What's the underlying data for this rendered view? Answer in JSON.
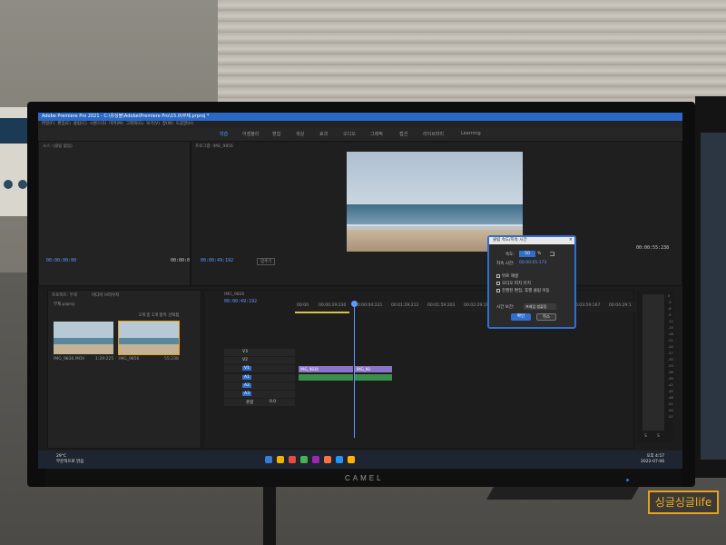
{
  "app": {
    "title": "Adobe Premiere Pro 2021 - C:\\유싱블\\Adobe\\Premiere Pro\\15.0\\무제.prproj *",
    "menu": [
      "파일(F)",
      "편집(E)",
      "클립(C)",
      "시퀀스(S)",
      "마커(M)",
      "그래픽(G)",
      "보기(V)",
      "창(W)",
      "도움말(H)"
    ],
    "workspaces": [
      "학습",
      "어셈블리",
      "편집",
      "색상",
      "효과",
      "오디오",
      "그래픽",
      "캡션",
      "라이브러리",
      "Learning"
    ],
    "active_workspace": "학습"
  },
  "source_panel": {
    "title": "소스: (클립 없음)",
    "timecode_left": "00:00:00:00",
    "timecode_right": "00:00:0"
  },
  "program_panel": {
    "title": "프로그램: IMG_9856",
    "timecode": "00:00:49:192",
    "fit": "맞추기",
    "duration": "00:00:55:238"
  },
  "project_panel": {
    "tabs": [
      "프로젝트: 무제",
      "미디어 브라우저"
    ],
    "file": "무제.prproj",
    "selection": "2개 중 1개 항목 선택됨",
    "items": [
      {
        "name": "IMG_9836.MOV",
        "duration": "1:29:225"
      },
      {
        "name": "IMG_9856",
        "duration": "55:238"
      }
    ]
  },
  "timeline": {
    "tab": "IMG_9856",
    "timecode": "00:00:49:192",
    "ruler": [
      "00:00",
      "00:00:29:230",
      "00:00:04:221",
      "00:01:29:212",
      "00:01:59:203",
      "00:02:29:194",
      "00:02:59:185",
      "00:03:29:176",
      "00:03:59:167",
      "00:04:29:1"
    ],
    "video_tracks": [
      "V3",
      "V2",
      "V1"
    ],
    "audio_tracks": [
      "A1",
      "A2",
      "A3"
    ],
    "mix_label": "혼합",
    "mix_value": "0.0",
    "clips": [
      "IMG_9836",
      "IMG_98"
    ]
  },
  "meter": {
    "ticks": [
      "0",
      "-3",
      "-6",
      "-9",
      "-12",
      "-15",
      "-18",
      "-21",
      "-24",
      "-27",
      "-30",
      "-33",
      "-36",
      "-39",
      "-42",
      "-45",
      "-48",
      "-51",
      "-54",
      "-57"
    ],
    "solo": [
      "S",
      "S"
    ]
  },
  "dialog": {
    "title": "클립 속도/지속 시간",
    "speed_label": "속도:",
    "speed_value": "50",
    "speed_unit": "%",
    "duration_label": "지속 시간:",
    "duration_value": "00:00:05:173",
    "options": [
      "뒤로 재생",
      "오디오 피치 유지",
      "진행된 편집, 후행 클립 이동"
    ],
    "interp_label": "시간 보간:",
    "interp_value": "프레임 샘플링",
    "ok": "확인",
    "cancel": "취소"
  },
  "taskbar": {
    "weather_temp": "29°C",
    "weather_desc": "부분적으로 맑음",
    "time": "오후 4:57",
    "date": "2022-07-06",
    "icon_colors": [
      "#3a7bd5",
      "#f0b400",
      "#e84c3d",
      "#4caf50",
      "#9c27b0",
      "#ff7043",
      "#2196f3",
      "#ffb300"
    ]
  },
  "monitor": {
    "brand": "CAMEL"
  },
  "watermark": "싱글싱글life"
}
